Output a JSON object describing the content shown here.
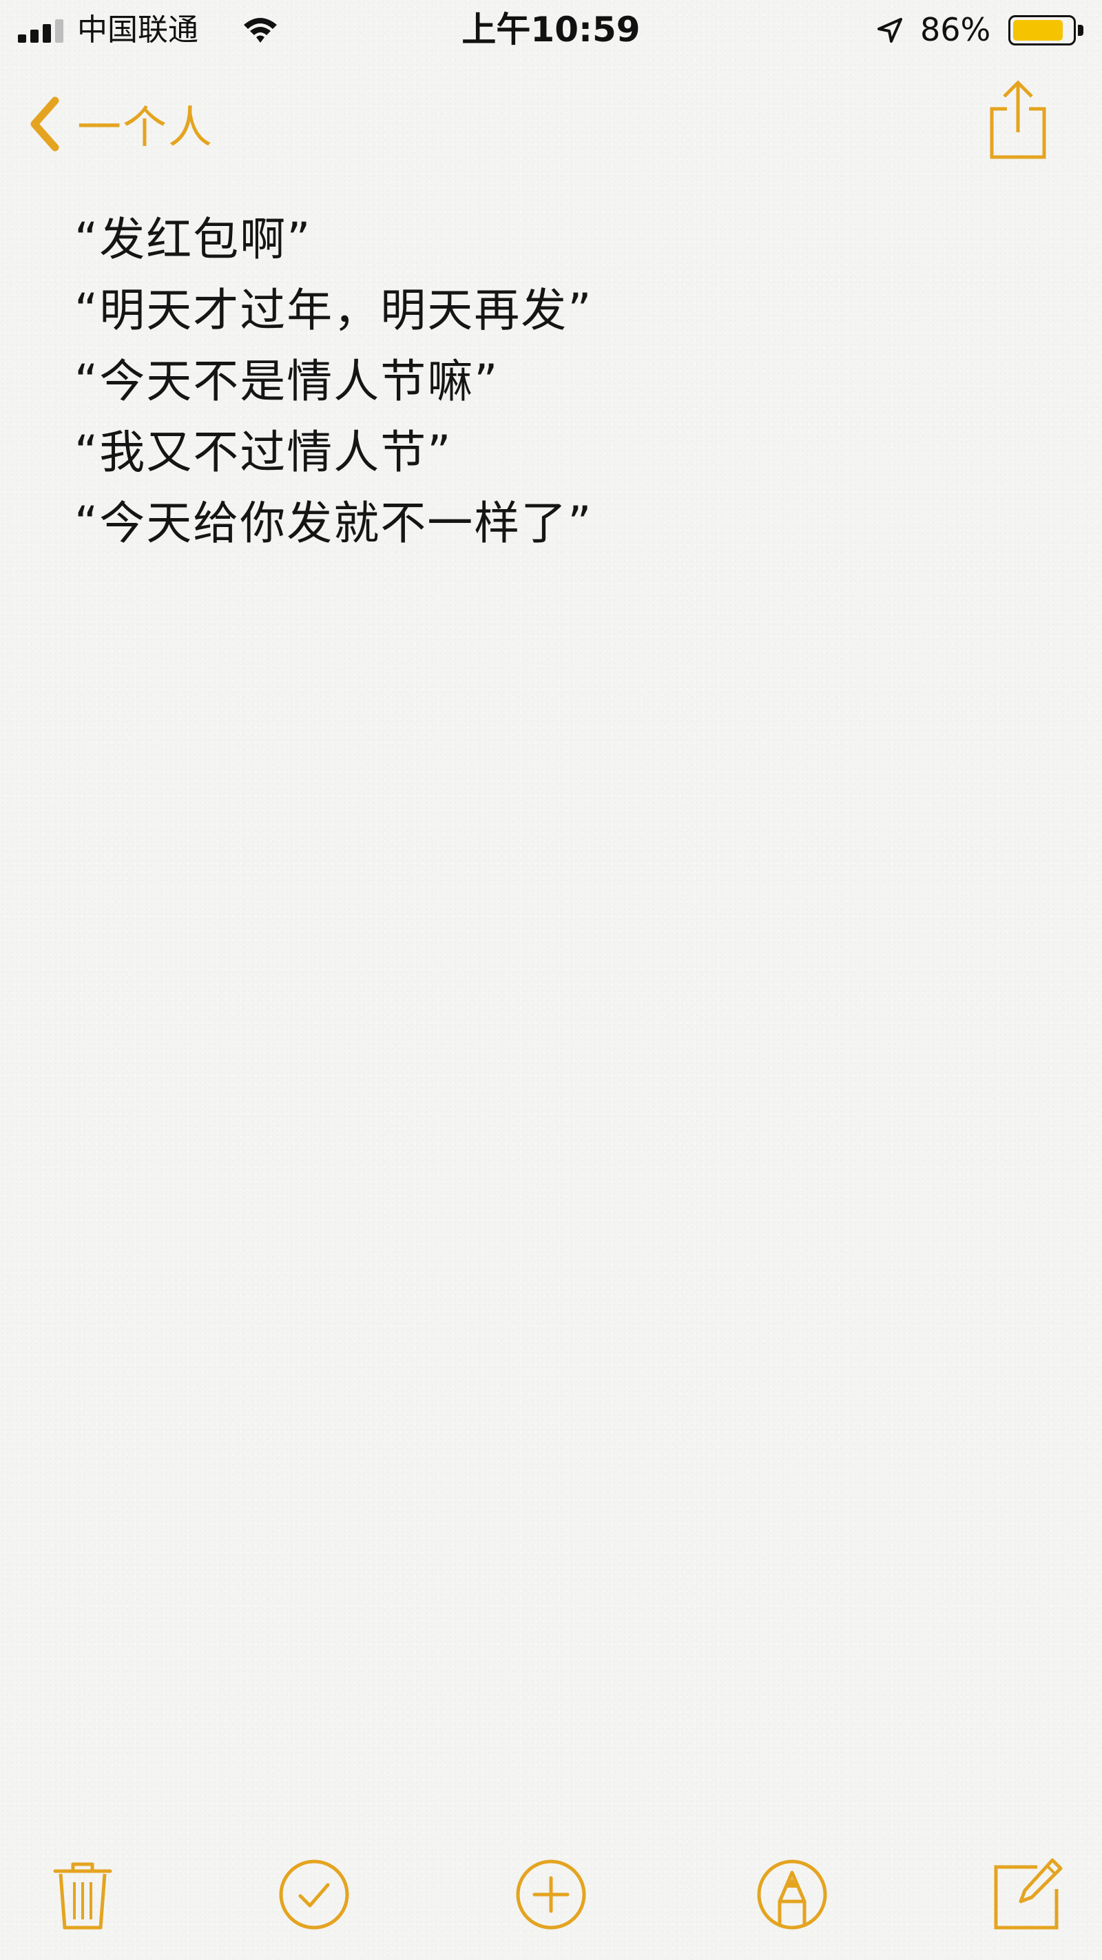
{
  "status_bar": {
    "carrier": "中国联通",
    "time": "上午10:59",
    "battery_percent_label": "86%",
    "battery_level": 0.86,
    "signal_bars": 4,
    "signal_bars_filled": 3,
    "icons": [
      "signal-icon",
      "wifi-icon",
      "location-arrow-icon",
      "battery-icon"
    ]
  },
  "nav": {
    "back_label": "一个人",
    "back_icon": "chevron-left-icon",
    "share_icon": "share-icon"
  },
  "note": {
    "lines": [
      "“发红包啊”",
      "“明天才过年，明天再发”",
      "“今天不是情人节嘛”",
      "“我又不过情人节”",
      "“今天给你发就不一样了”"
    ]
  },
  "toolbar": {
    "items": [
      "trash-icon",
      "checklist-icon",
      "add-icon",
      "markup-icon",
      "compose-icon"
    ]
  },
  "colors": {
    "accent": "#e4a420",
    "battery": "#f5c300",
    "text": "#151515",
    "background": "#f4f4f2"
  }
}
